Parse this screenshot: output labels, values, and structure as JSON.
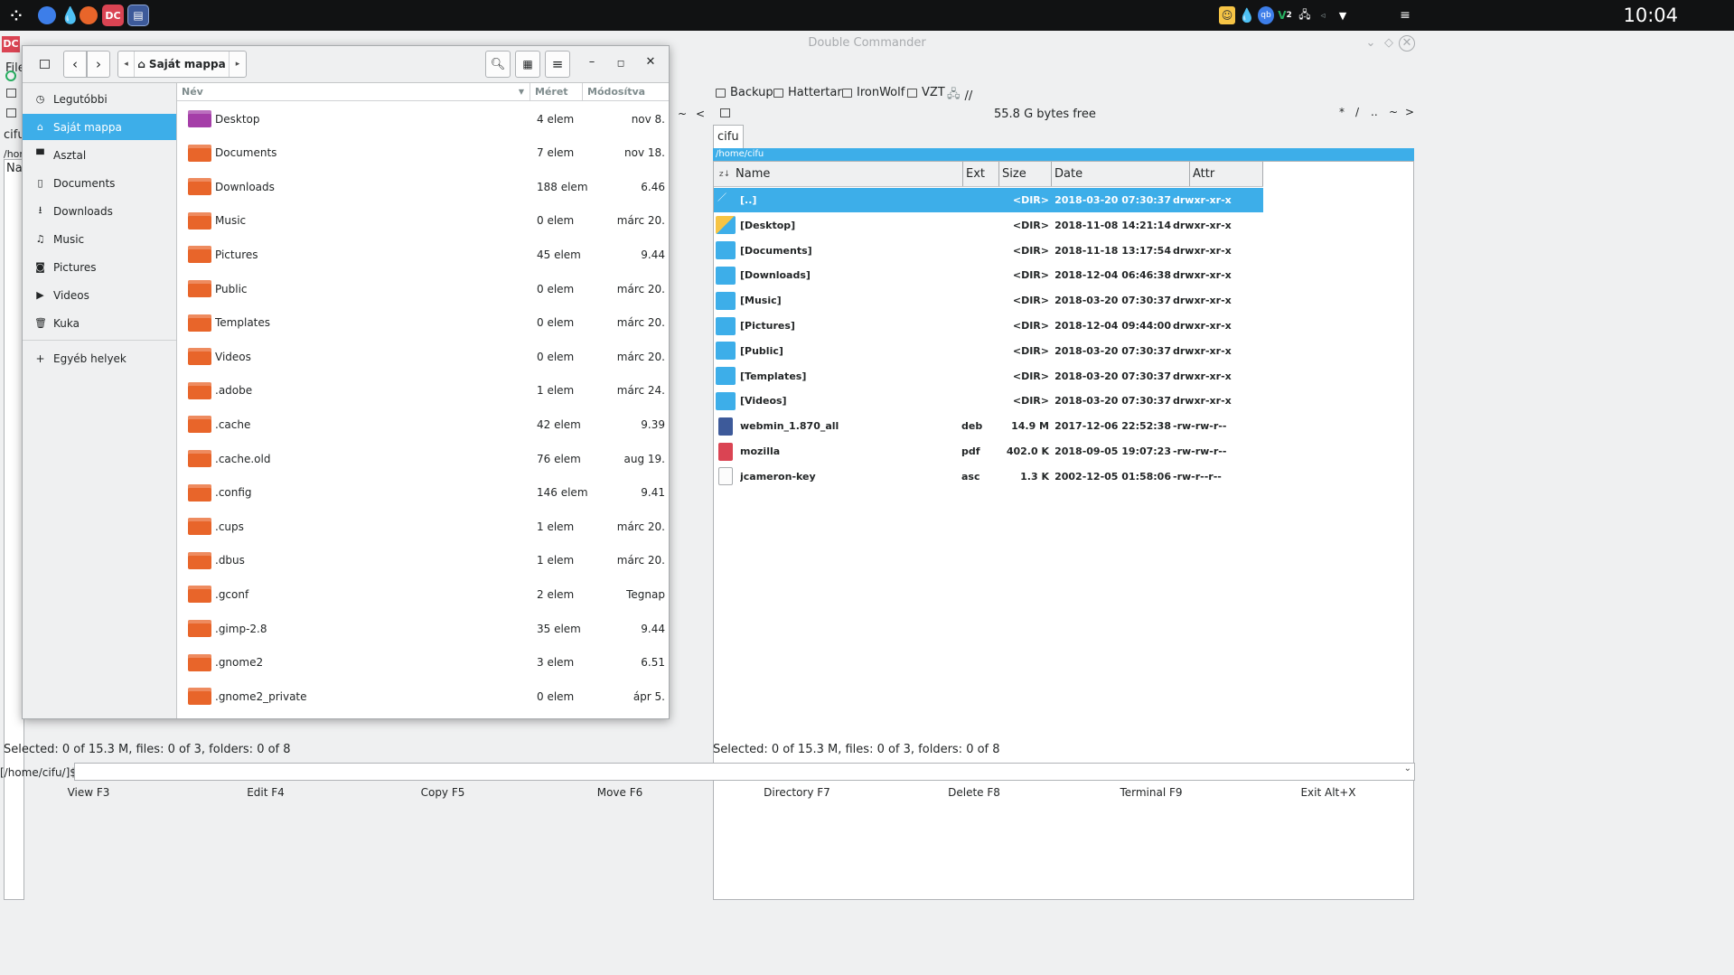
{
  "taskbar": {
    "clock": "10:04",
    "left_icons": [
      "app-launcher-icon",
      "browser-icon",
      "droplet-icon",
      "firefox-icon",
      "double-commander-icon",
      "file-manager-icon"
    ],
    "tray_labels": {
      "qb": "qb",
      "v": "V",
      "lang": "2"
    }
  },
  "dc": {
    "title": "Double Commander",
    "menu_file": "File",
    "left_tab_partial": "cifu",
    "left_path_partial": "/hom",
    "left_col_partial": "Na",
    "drives": [
      {
        "label": "Backup"
      },
      {
        "label": "Hattertar"
      },
      {
        "label": "IronWolf"
      },
      {
        "label": "VZT"
      },
      {
        "label": "//"
      }
    ],
    "right_info": {
      "free": "55.8 G bytes free",
      "nav": [
        "*",
        "/",
        "..",
        "~",
        ">"
      ],
      "left_nav": [
        "~",
        "<"
      ]
    },
    "right_panel": {
      "tab": "cifu",
      "path": "/home/cifu",
      "columns": {
        "name": "Name",
        "ext": "Ext",
        "size": "Size",
        "date": "Date",
        "attr": "Attr"
      },
      "rows": [
        {
          "name": "[..]",
          "ext": "",
          "size": "<DIR>",
          "date": "2018-03-20 07:30:37",
          "attr": "drwxr-xr-x",
          "icon": "up-icon",
          "selected": true
        },
        {
          "name": "[Desktop]",
          "ext": "",
          "size": "<DIR>",
          "date": "2018-11-08 14:21:14",
          "attr": "drwxr-xr-x",
          "icon": "desktop-folder-icon"
        },
        {
          "name": "[Documents]",
          "ext": "",
          "size": "<DIR>",
          "date": "2018-11-18 13:17:54",
          "attr": "drwxr-xr-x",
          "icon": "documents-folder-icon"
        },
        {
          "name": "[Downloads]",
          "ext": "",
          "size": "<DIR>",
          "date": "2018-12-04 06:46:38",
          "attr": "drwxr-xr-x",
          "icon": "downloads-folder-icon"
        },
        {
          "name": "[Music]",
          "ext": "",
          "size": "<DIR>",
          "date": "2018-03-20 07:30:37",
          "attr": "drwxr-xr-x",
          "icon": "music-folder-icon"
        },
        {
          "name": "[Pictures]",
          "ext": "",
          "size": "<DIR>",
          "date": "2018-12-04 09:44:00",
          "attr": "drwxr-xr-x",
          "icon": "pictures-folder-icon"
        },
        {
          "name": "[Public]",
          "ext": "",
          "size": "<DIR>",
          "date": "2018-03-20 07:30:37",
          "attr": "drwxr-xr-x",
          "icon": "public-folder-icon"
        },
        {
          "name": "[Templates]",
          "ext": "",
          "size": "<DIR>",
          "date": "2018-03-20 07:30:37",
          "attr": "drwxr-xr-x",
          "icon": "templates-folder-icon"
        },
        {
          "name": "[Videos]",
          "ext": "",
          "size": "<DIR>",
          "date": "2018-03-20 07:30:37",
          "attr": "drwxr-xr-x",
          "icon": "videos-folder-icon"
        },
        {
          "name": "webmin_1.870_all",
          "ext": "deb",
          "size": "14.9 M",
          "date": "2017-12-06 22:52:38",
          "attr": "-rw-rw-r--",
          "icon": "deb-package-icon"
        },
        {
          "name": "mozilla",
          "ext": "pdf",
          "size": "402.0 K",
          "date": "2018-09-05 19:07:23",
          "attr": "-rw-rw-r--",
          "icon": "pdf-file-icon"
        },
        {
          "name": "jcameron-key",
          "ext": "asc",
          "size": "1.3 K",
          "date": "2002-12-05 01:58:06",
          "attr": "-rw-r--r--",
          "icon": "text-file-icon"
        }
      ]
    },
    "status_left": "Selected: 0 of 15.3 M, files: 0 of 3, folders: 0 of 8",
    "status_right": "Selected: 0 of 15.3 M, files: 0 of 3, folders: 0 of 8",
    "cmd_prompt": "[/home/cifu/]$:",
    "fkeys": [
      "View F3",
      "Edit F4",
      "Copy F5",
      "Move F6",
      "Directory F7",
      "Delete F8",
      "Terminal F9",
      "Exit Alt+X"
    ]
  },
  "dialog": {
    "crumb": "Saját mappa",
    "sidebar": [
      {
        "label": "Legutóbbi",
        "icon": "clock-icon"
      },
      {
        "label": "Saját mappa",
        "icon": "home-icon",
        "active": true
      },
      {
        "label": "Asztal",
        "icon": "desktop-icon"
      },
      {
        "label": "Documents",
        "icon": "document-icon"
      },
      {
        "label": "Downloads",
        "icon": "download-icon"
      },
      {
        "label": "Music",
        "icon": "music-icon"
      },
      {
        "label": "Pictures",
        "icon": "camera-icon"
      },
      {
        "label": "Videos",
        "icon": "video-icon"
      },
      {
        "label": "Kuka",
        "icon": "trash-icon"
      }
    ],
    "other_places": "Egyéb helyek",
    "columns": {
      "name": "Név",
      "size": "Méret",
      "modified": "Módosítva"
    },
    "files": [
      {
        "name": "Desktop",
        "size": "4 elem",
        "modified": "nov 8.",
        "color": "#a53ea8"
      },
      {
        "name": "Documents",
        "size": "7 elem",
        "modified": "nov 18.",
        "color": "#e8652a"
      },
      {
        "name": "Downloads",
        "size": "188 elem",
        "modified": "6.46",
        "color": "#e8652a"
      },
      {
        "name": "Music",
        "size": "0 elem",
        "modified": "márc 20.",
        "color": "#e8652a"
      },
      {
        "name": "Pictures",
        "size": "45 elem",
        "modified": "9.44",
        "color": "#e8652a"
      },
      {
        "name": "Public",
        "size": "0 elem",
        "modified": "márc 20.",
        "color": "#e8652a"
      },
      {
        "name": "Templates",
        "size": "0 elem",
        "modified": "márc 20.",
        "color": "#e8652a"
      },
      {
        "name": "Videos",
        "size": "0 elem",
        "modified": "márc 20.",
        "color": "#e8652a"
      },
      {
        "name": ".adobe",
        "size": "1 elem",
        "modified": "márc 24.",
        "color": "#e8652a"
      },
      {
        "name": ".cache",
        "size": "42 elem",
        "modified": "9.39",
        "color": "#e8652a"
      },
      {
        "name": ".cache.old",
        "size": "76 elem",
        "modified": "aug 19.",
        "color": "#e8652a"
      },
      {
        "name": ".config",
        "size": "146 elem",
        "modified": "9.41",
        "color": "#e8652a"
      },
      {
        "name": ".cups",
        "size": "1 elem",
        "modified": "márc 20.",
        "color": "#e8652a"
      },
      {
        "name": ".dbus",
        "size": "1 elem",
        "modified": "márc 20.",
        "color": "#e8652a"
      },
      {
        "name": ".gconf",
        "size": "2 elem",
        "modified": "Tegnap",
        "color": "#e8652a"
      },
      {
        "name": ".gimp-2.8",
        "size": "35 elem",
        "modified": "9.44",
        "color": "#e8652a"
      },
      {
        "name": ".gnome2",
        "size": "3 elem",
        "modified": "6.51",
        "color": "#e8652a"
      },
      {
        "name": ".gnome2_private",
        "size": "0 elem",
        "modified": "ápr 5.",
        "color": "#e8652a"
      }
    ]
  },
  "colors": {
    "accent": "#3daee9",
    "folder": "#e8652a",
    "dc_folder": "#3daee9",
    "pdf": "#da4453"
  }
}
